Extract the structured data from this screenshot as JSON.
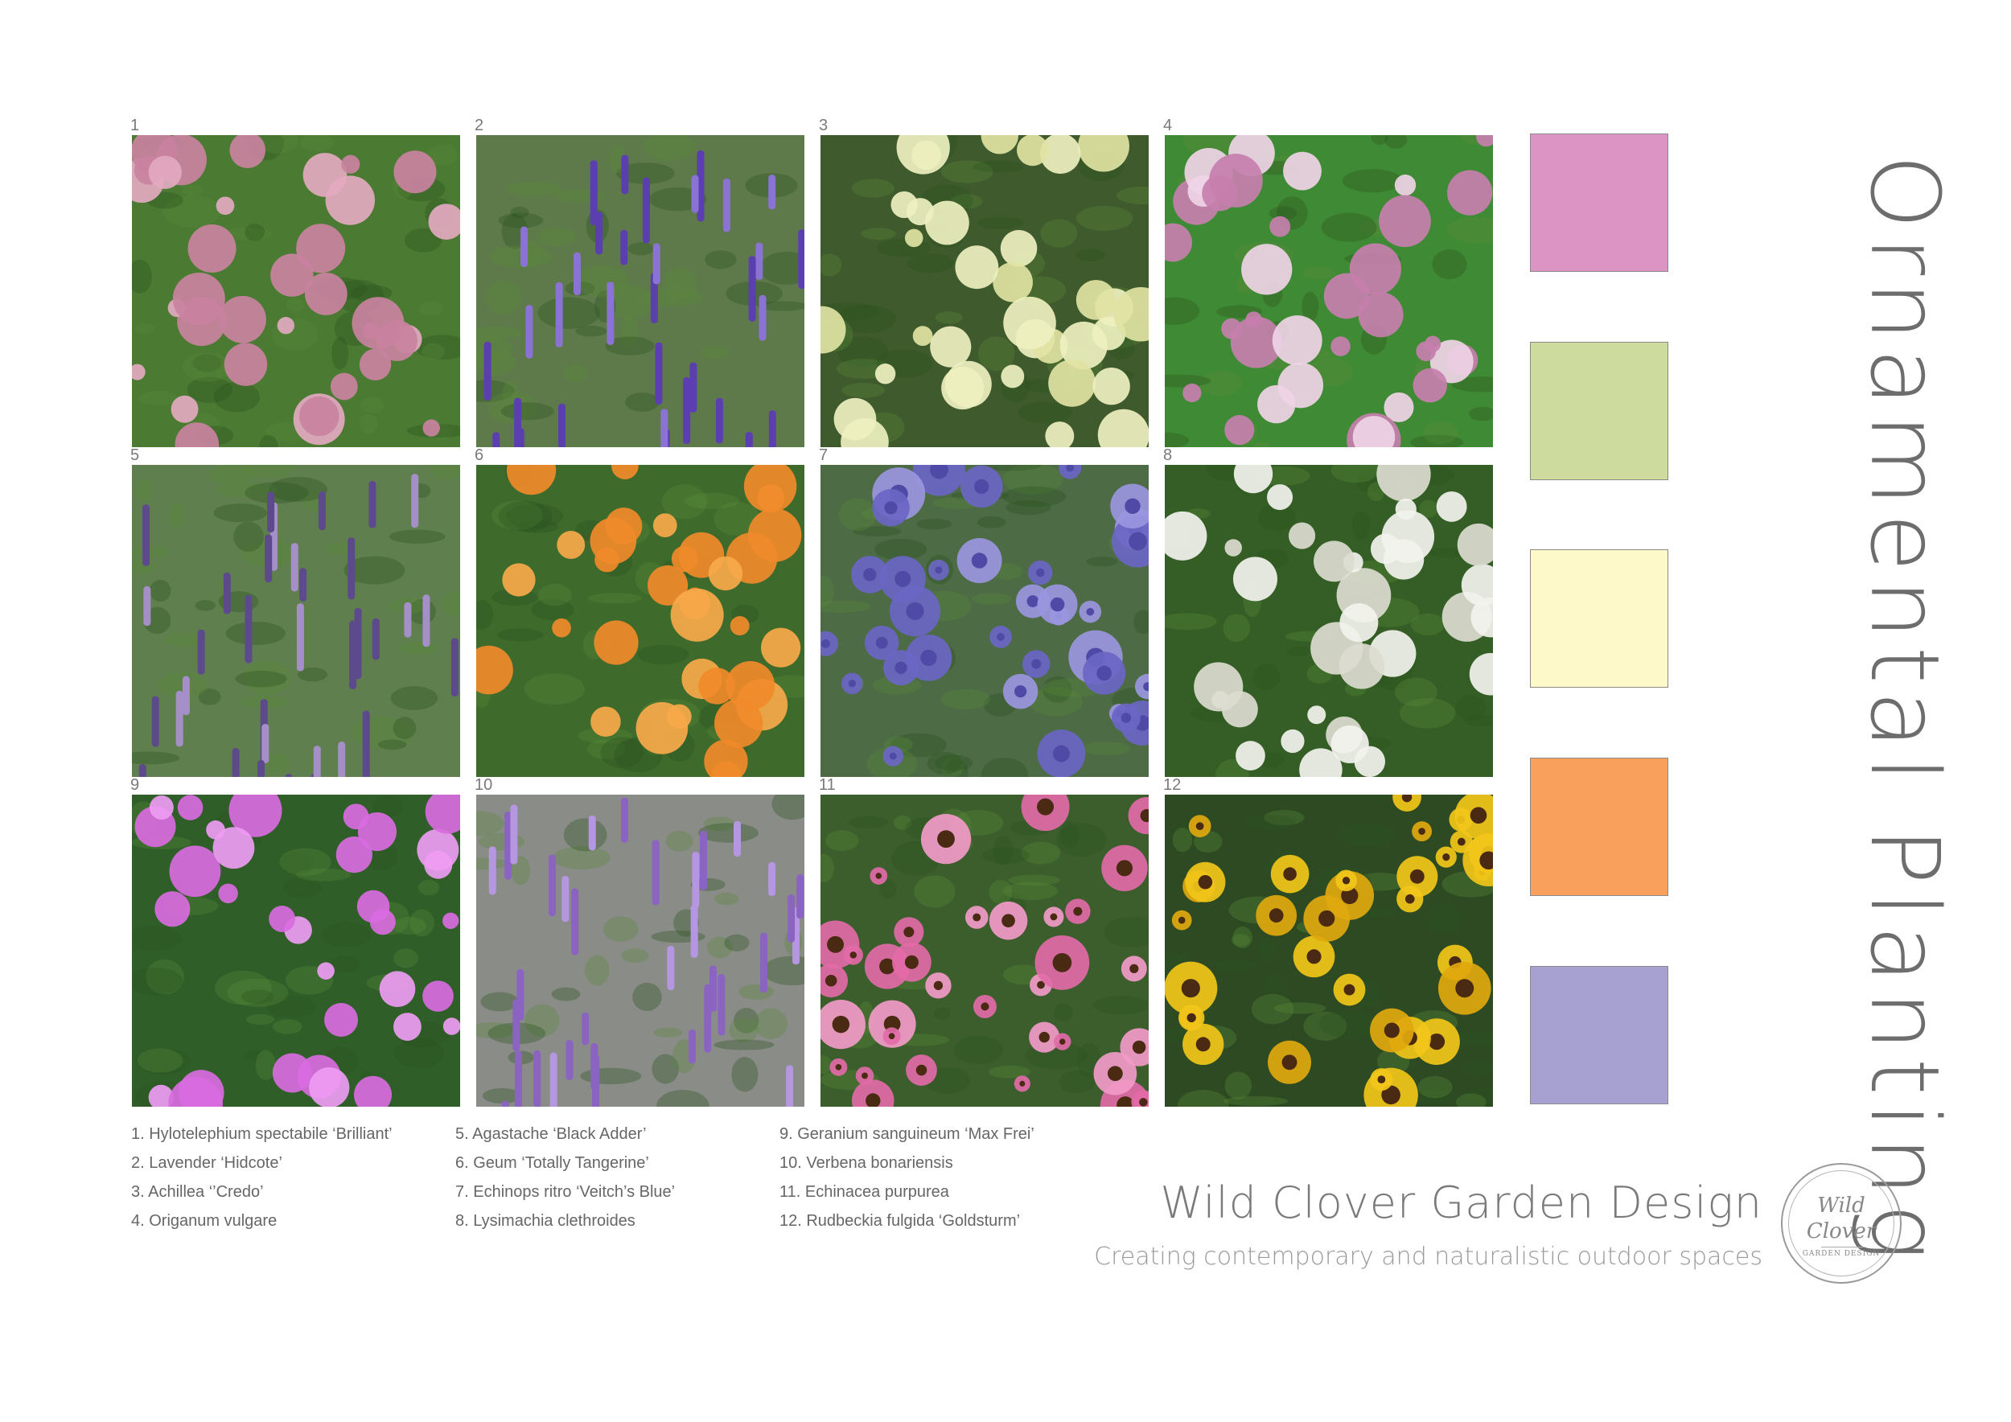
{
  "title": "Ornamental Planting",
  "plants": [
    {
      "number": "1",
      "caption": "1. Hylotelephium spectabile ‘Brilliant’",
      "photo": "sedum-photo",
      "colors": {
        "bg": "#4b7a32",
        "flower": "#c9829f",
        "flower2": "#e3a9c0"
      }
    },
    {
      "number": "2",
      "caption": "2. Lavender ‘Hidcote’",
      "photo": "lavender-photo",
      "colors": {
        "bg": "#5e7a4a",
        "flower": "#5b3fb0",
        "flower2": "#8a73d4"
      }
    },
    {
      "number": "3",
      "caption": "3. Achillea ‘’Credo’",
      "photo": "achillea-photo",
      "colors": {
        "bg": "#3f5a2c",
        "flower": "#eef0c0",
        "flower2": "#dfe3a3"
      }
    },
    {
      "number": "4",
      "caption": "4. Origanum vulgare",
      "photo": "oregano-photo",
      "colors": {
        "bg": "#3f8a34",
        "flower": "#c77fae",
        "flower2": "#efd4e6"
      }
    },
    {
      "number": "5",
      "caption": "5. Agastache ‘Black Adder’",
      "photo": "agastache-photo",
      "colors": {
        "bg": "#5f7f4e",
        "flower": "#5d4a8c",
        "flower2": "#a58fc8"
      }
    },
    {
      "number": "6",
      "caption": "6. Geum ‘Totally Tangerine’",
      "photo": "geum-photo",
      "colors": {
        "bg": "#3e6b2c",
        "flower": "#f08a2a",
        "flower2": "#f7a94a"
      }
    },
    {
      "number": "7",
      "caption": "7. Echinops ritro ‘Veitch’s Blue’",
      "photo": "echinops-photo",
      "colors": {
        "bg": "#4d6b45",
        "flower": "#6a66c4",
        "flower2": "#9a96e0"
      }
    },
    {
      "number": "8",
      "caption": "8. Lysimachia clethroides",
      "photo": "lysimachia-photo",
      "colors": {
        "bg": "#355e26",
        "flower": "#f3f3ee",
        "flower2": "#dcdcd0"
      }
    },
    {
      "number": "9",
      "caption": "9. Geranium sanguineum ‘Max Frei’",
      "photo": "geranium-photo",
      "colors": {
        "bg": "#2f5e28",
        "flower": "#d96be0",
        "flower2": "#ee9cf2"
      }
    },
    {
      "number": "10",
      "caption": "10. Verbena bonariensis",
      "photo": "verbena-photo",
      "colors": {
        "bg": "#8a8c88",
        "flower": "#8a64c0",
        "flower2": "#b497e0"
      }
    },
    {
      "number": "11",
      "caption": "11. Echinacea purpurea",
      "photo": "echinacea-photo",
      "colors": {
        "bg": "#3b5e2c",
        "flower": "#e26aa8",
        "flower2": "#f29ac8"
      }
    },
    {
      "number": "12",
      "caption": "12. Rudbeckia fulgida ‘Goldsturm’",
      "photo": "rudbeckia-photo",
      "colors": {
        "bg": "#2d4a22",
        "flower": "#f2c619",
        "flower2": "#e0a80e"
      }
    }
  ],
  "palette": [
    "#db94c3",
    "#cedb9f",
    "#fdf9c8",
    "#f9a05c",
    "#a6a1d0"
  ],
  "brand": {
    "name": "Wild Clover Garden Design",
    "tagline": "Creating contemporary and naturalistic outdoor spaces",
    "logo_line1": "Wild",
    "logo_line2": "Clover",
    "logo_line3": "GARDEN DESIGN"
  }
}
